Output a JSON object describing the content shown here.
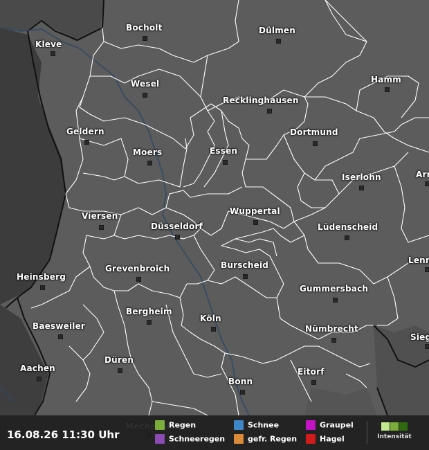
{
  "timestamp": "16.08.26 11:30 Uhr",
  "legend": {
    "items": [
      {
        "label": "Regen",
        "color": "#7cad3a"
      },
      {
        "label": "Schneeregen",
        "color": "#8a4bb3"
      },
      {
        "label": "Schnee",
        "color": "#3f86c6"
      },
      {
        "label": "gefr. Regen",
        "color": "#d98b3a"
      },
      {
        "label": "Graupel",
        "color": "#c413c4"
      },
      {
        "label": "Hagel",
        "color": "#d11a1a"
      }
    ],
    "intensity_label": "Intensität",
    "intensity_colors": [
      "#c4ea8f",
      "#7cad3a",
      "#2f6a12"
    ]
  },
  "cities": [
    {
      "name": "Bocholt"
    },
    {
      "name": "Dülmen"
    },
    {
      "name": "Kleve"
    },
    {
      "name": "Wesel"
    },
    {
      "name": "Hamm"
    },
    {
      "name": "Recklinghausen"
    },
    {
      "name": "Geldern"
    },
    {
      "name": "Dortmund"
    },
    {
      "name": "Moers"
    },
    {
      "name": "Essen"
    },
    {
      "name": "Iserlohn"
    },
    {
      "name": "Arn"
    },
    {
      "name": "Wuppertal"
    },
    {
      "name": "Viersen"
    },
    {
      "name": "Düsseldorf"
    },
    {
      "name": "Lüdenscheid"
    },
    {
      "name": "Lenn"
    },
    {
      "name": "Grevenbroich"
    },
    {
      "name": "Burscheid"
    },
    {
      "name": "Heinsberg"
    },
    {
      "name": "Gummersbach"
    },
    {
      "name": "Bergheim"
    },
    {
      "name": "Baesweiler"
    },
    {
      "name": "Köln"
    },
    {
      "name": "Nümbrecht"
    },
    {
      "name": "Sieg"
    },
    {
      "name": "Aachen"
    },
    {
      "name": "Düren"
    },
    {
      "name": "Eitorf"
    },
    {
      "name": "Bonn"
    },
    {
      "name": "Mechernich"
    }
  ]
}
